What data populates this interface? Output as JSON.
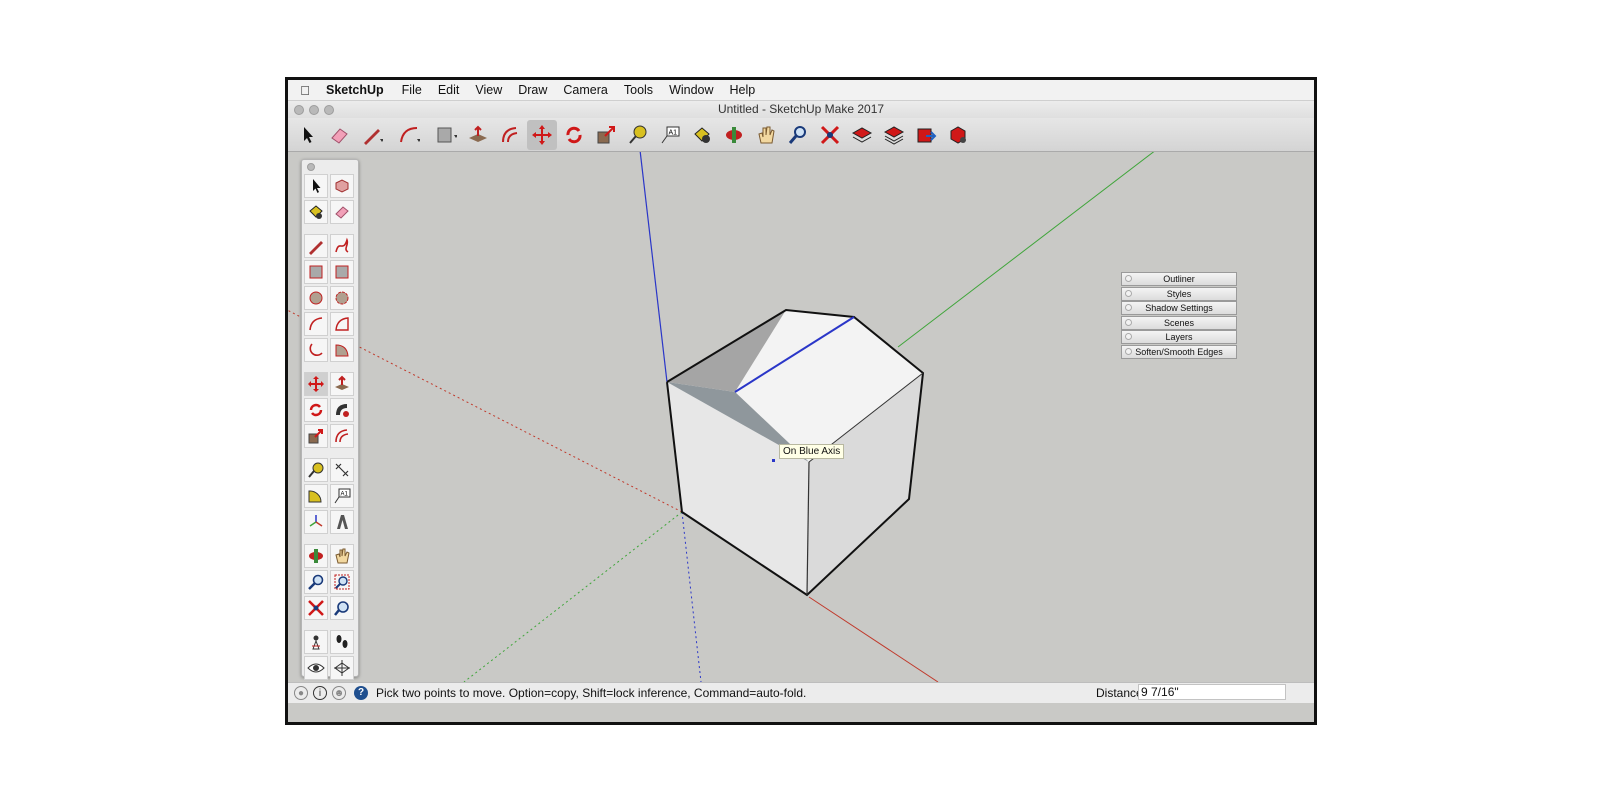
{
  "menubar": {
    "app_name": "SketchUp",
    "items": [
      "File",
      "Edit",
      "View",
      "Draw",
      "Camera",
      "Tools",
      "Window",
      "Help"
    ]
  },
  "window": {
    "title": "Untitled - SketchUp Make 2017"
  },
  "toolbar": {
    "tools": [
      "select-tool",
      "eraser-tool",
      "line-tool",
      "arc-tool",
      "rectangle-tool",
      "push-pull-tool",
      "offset-tool",
      "move-tool",
      "rotate-tool",
      "scale-tool",
      "tape-measure-tool",
      "text-tool",
      "paint-bucket-tool",
      "orbit-tool",
      "pan-tool",
      "zoom-tool",
      "zoom-extents-tool",
      "warehouse-tool",
      "components-tool",
      "share-model-tool",
      "extension-warehouse-tool"
    ],
    "active": "move-tool"
  },
  "tool_palette": {
    "active": "move-tool",
    "groups": [
      [
        "select",
        "component",
        "paint-bucket",
        "eraser"
      ],
      [
        "line",
        "freehand",
        "rectangle",
        "rotated-rectangle",
        "circle",
        "polygon",
        "arc",
        "two-point-arc",
        "three-point-arc",
        "pie"
      ],
      [
        "move",
        "push-pull",
        "rotate",
        "follow-me",
        "scale",
        "offset"
      ],
      [
        "tape-measure",
        "dimension",
        "protractor",
        "text",
        "axes",
        "3d-text"
      ],
      [
        "orbit",
        "pan",
        "zoom",
        "zoom-window",
        "zoom-extents",
        "previous-view"
      ],
      [
        "position-camera",
        "walk",
        "look-around",
        "section-plane"
      ]
    ]
  },
  "panels": [
    "Outliner",
    "Styles",
    "Shadow Settings",
    "Scenes",
    "Layers",
    "Soften/Smooth Edges"
  ],
  "viewport": {
    "tooltip": "On Blue Axis",
    "axis_colors": {
      "red": "#c0392b",
      "green": "#3fa53a",
      "blue": "#2a36c8"
    }
  },
  "statusbar": {
    "hint": "Pick two points to move.  Option=copy, Shift=lock inference, Command=auto-fold.",
    "distance_label": "Distance",
    "distance_value": "9 7/16\"",
    "icons": [
      "geo-location-icon",
      "credits-icon",
      "user-icon",
      "help-icon"
    ]
  }
}
